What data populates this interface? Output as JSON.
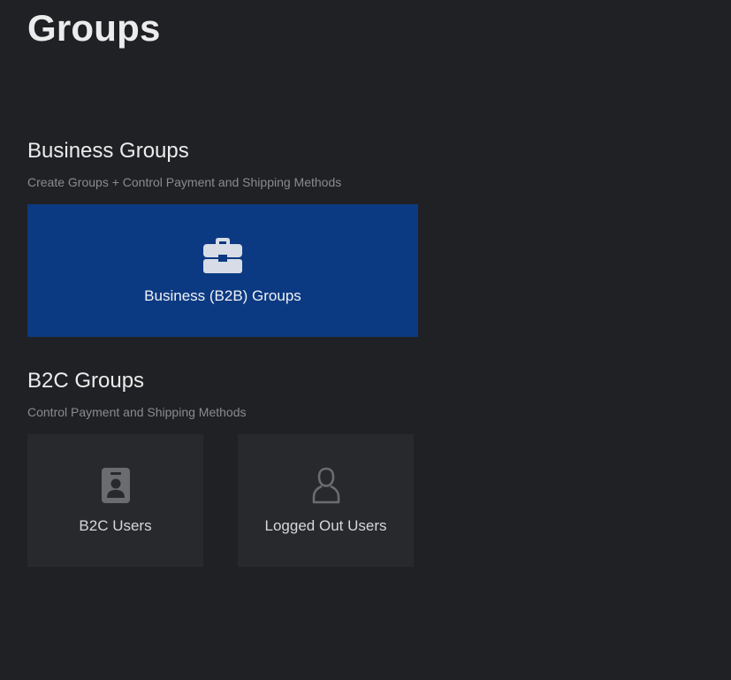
{
  "page": {
    "title": "Groups"
  },
  "business": {
    "title": "Business Groups",
    "subtitle": "Create Groups + Control Payment and Shipping Methods",
    "tile": {
      "label": "Business (B2B) Groups",
      "icon": "briefcase-icon",
      "color": "#0c3a82"
    }
  },
  "b2c": {
    "title": "B2C Groups",
    "subtitle": "Control Payment and Shipping Methods",
    "tiles": [
      {
        "label": "B2C Users",
        "icon": "id-badge-icon"
      },
      {
        "label": "Logged Out Users",
        "icon": "user-outline-icon"
      }
    ]
  },
  "colors": {
    "background": "#202124",
    "tile": "#28292d",
    "accent": "#0c3a82"
  }
}
